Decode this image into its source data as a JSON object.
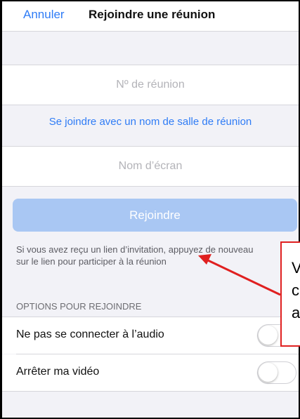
{
  "navbar": {
    "cancel_label": "Annuler",
    "title": "Rejoindre une réunion"
  },
  "form": {
    "meeting_id_placeholder": "Nº de réunion",
    "join_by_room_name_link": "Se joindre avec un nom de salle de réunion",
    "screen_name_placeholder": "Nom d’écran",
    "join_button_label": "Rejoindre",
    "hint_text": "Si vous avez reçu un lien d’invitation, appuyez de nouveau sur le lien pour participer à la réunion"
  },
  "options": {
    "section_header": "OPTIONS POUR REJOINDRE",
    "items": [
      {
        "label": "Ne pas se connecter à l’audio",
        "enabled": false
      },
      {
        "label": "Arrêter ma vidéo",
        "enabled": false
      }
    ]
  },
  "callout": {
    "lines": [
      "V",
      "c",
      "a"
    ],
    "border_color": "#e02020",
    "arrow_color": "#e02020"
  },
  "colors": {
    "accent": "#2f7cf6",
    "join_button_disabled": "#a9c7f3",
    "background": "#f2f2f7"
  }
}
